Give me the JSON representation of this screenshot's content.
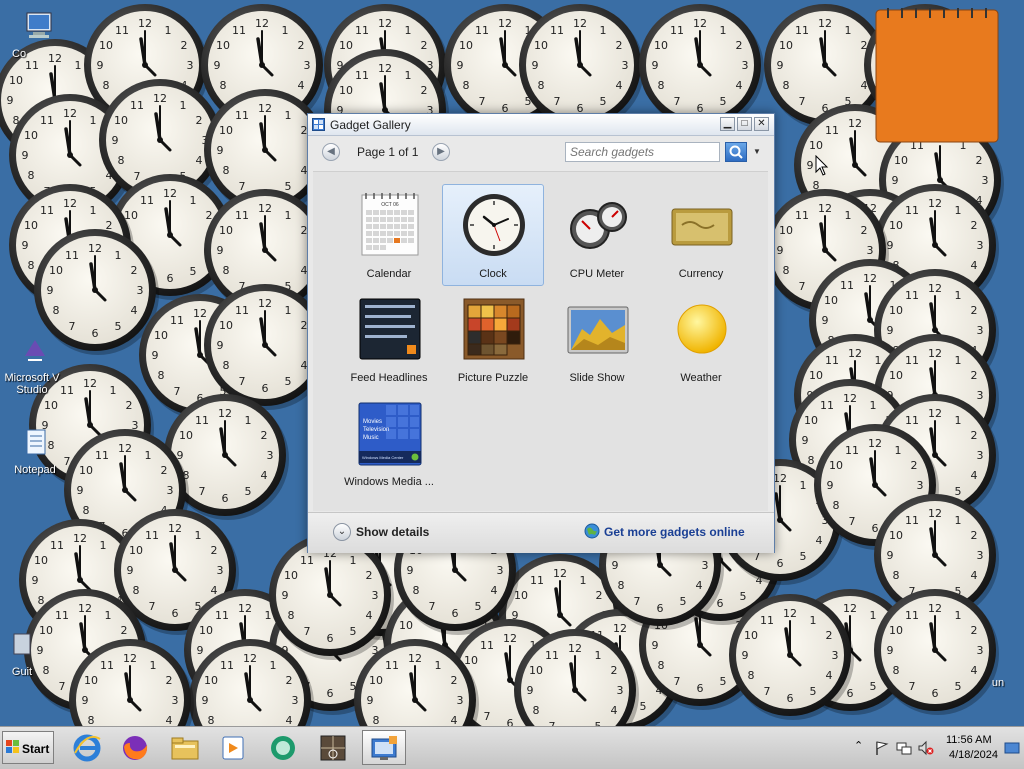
{
  "desktop": {
    "icons": [
      {
        "label": "Co",
        "icon": "computer-icon"
      },
      {
        "label": "Microsoft V Studio",
        "icon": "visual-studio-icon"
      },
      {
        "label": "Notepad",
        "icon": "notepad-icon"
      },
      {
        "label": "Guit",
        "icon": "shortcut-icon"
      },
      {
        "label": "un",
        "icon": "shortcut-icon"
      }
    ],
    "clock_gadget_count": 58
  },
  "gallery": {
    "title": "Gadget Gallery",
    "page_label": "Page 1 of 1",
    "search_placeholder": "Search gadgets",
    "gadgets": [
      {
        "label": "Calendar",
        "icon": "calendar-icon",
        "selected": false
      },
      {
        "label": "Clock",
        "icon": "clock-icon",
        "selected": true
      },
      {
        "label": "CPU Meter",
        "icon": "cpu-meter-icon",
        "selected": false
      },
      {
        "label": "Currency",
        "icon": "currency-icon",
        "selected": false
      },
      {
        "label": "Feed Headlines",
        "icon": "feed-headlines-icon",
        "selected": false
      },
      {
        "label": "Picture Puzzle",
        "icon": "picture-puzzle-icon",
        "selected": false
      },
      {
        "label": "Slide Show",
        "icon": "slide-show-icon",
        "selected": false
      },
      {
        "label": "Weather",
        "icon": "weather-icon",
        "selected": false
      },
      {
        "label": "Windows Media ...",
        "icon": "windows-media-icon",
        "selected": false
      }
    ],
    "calendar_thumb": {
      "month": "OCT 06"
    },
    "media_thumb": {
      "lines": [
        "Movies",
        "Television",
        "Music"
      ],
      "footer": "Windows Media Center"
    },
    "show_details_label": "Show details",
    "get_more_label": "Get more gadgets online"
  },
  "taskbar": {
    "start_label": "Start",
    "apps": [
      {
        "name": "internet-explorer-icon"
      },
      {
        "name": "firefox-icon"
      },
      {
        "name": "file-explorer-icon"
      },
      {
        "name": "media-player-icon"
      },
      {
        "name": "chat-icon"
      },
      {
        "name": "media-app-icon"
      },
      {
        "name": "gadget-gallery-icon",
        "active": true
      }
    ],
    "time": "11:56 AM",
    "date": "4/18/2024"
  },
  "colors": {
    "desktop": "#3a6ea5",
    "link": "#1a3f94",
    "selected_tile": "#c9dcf3"
  }
}
